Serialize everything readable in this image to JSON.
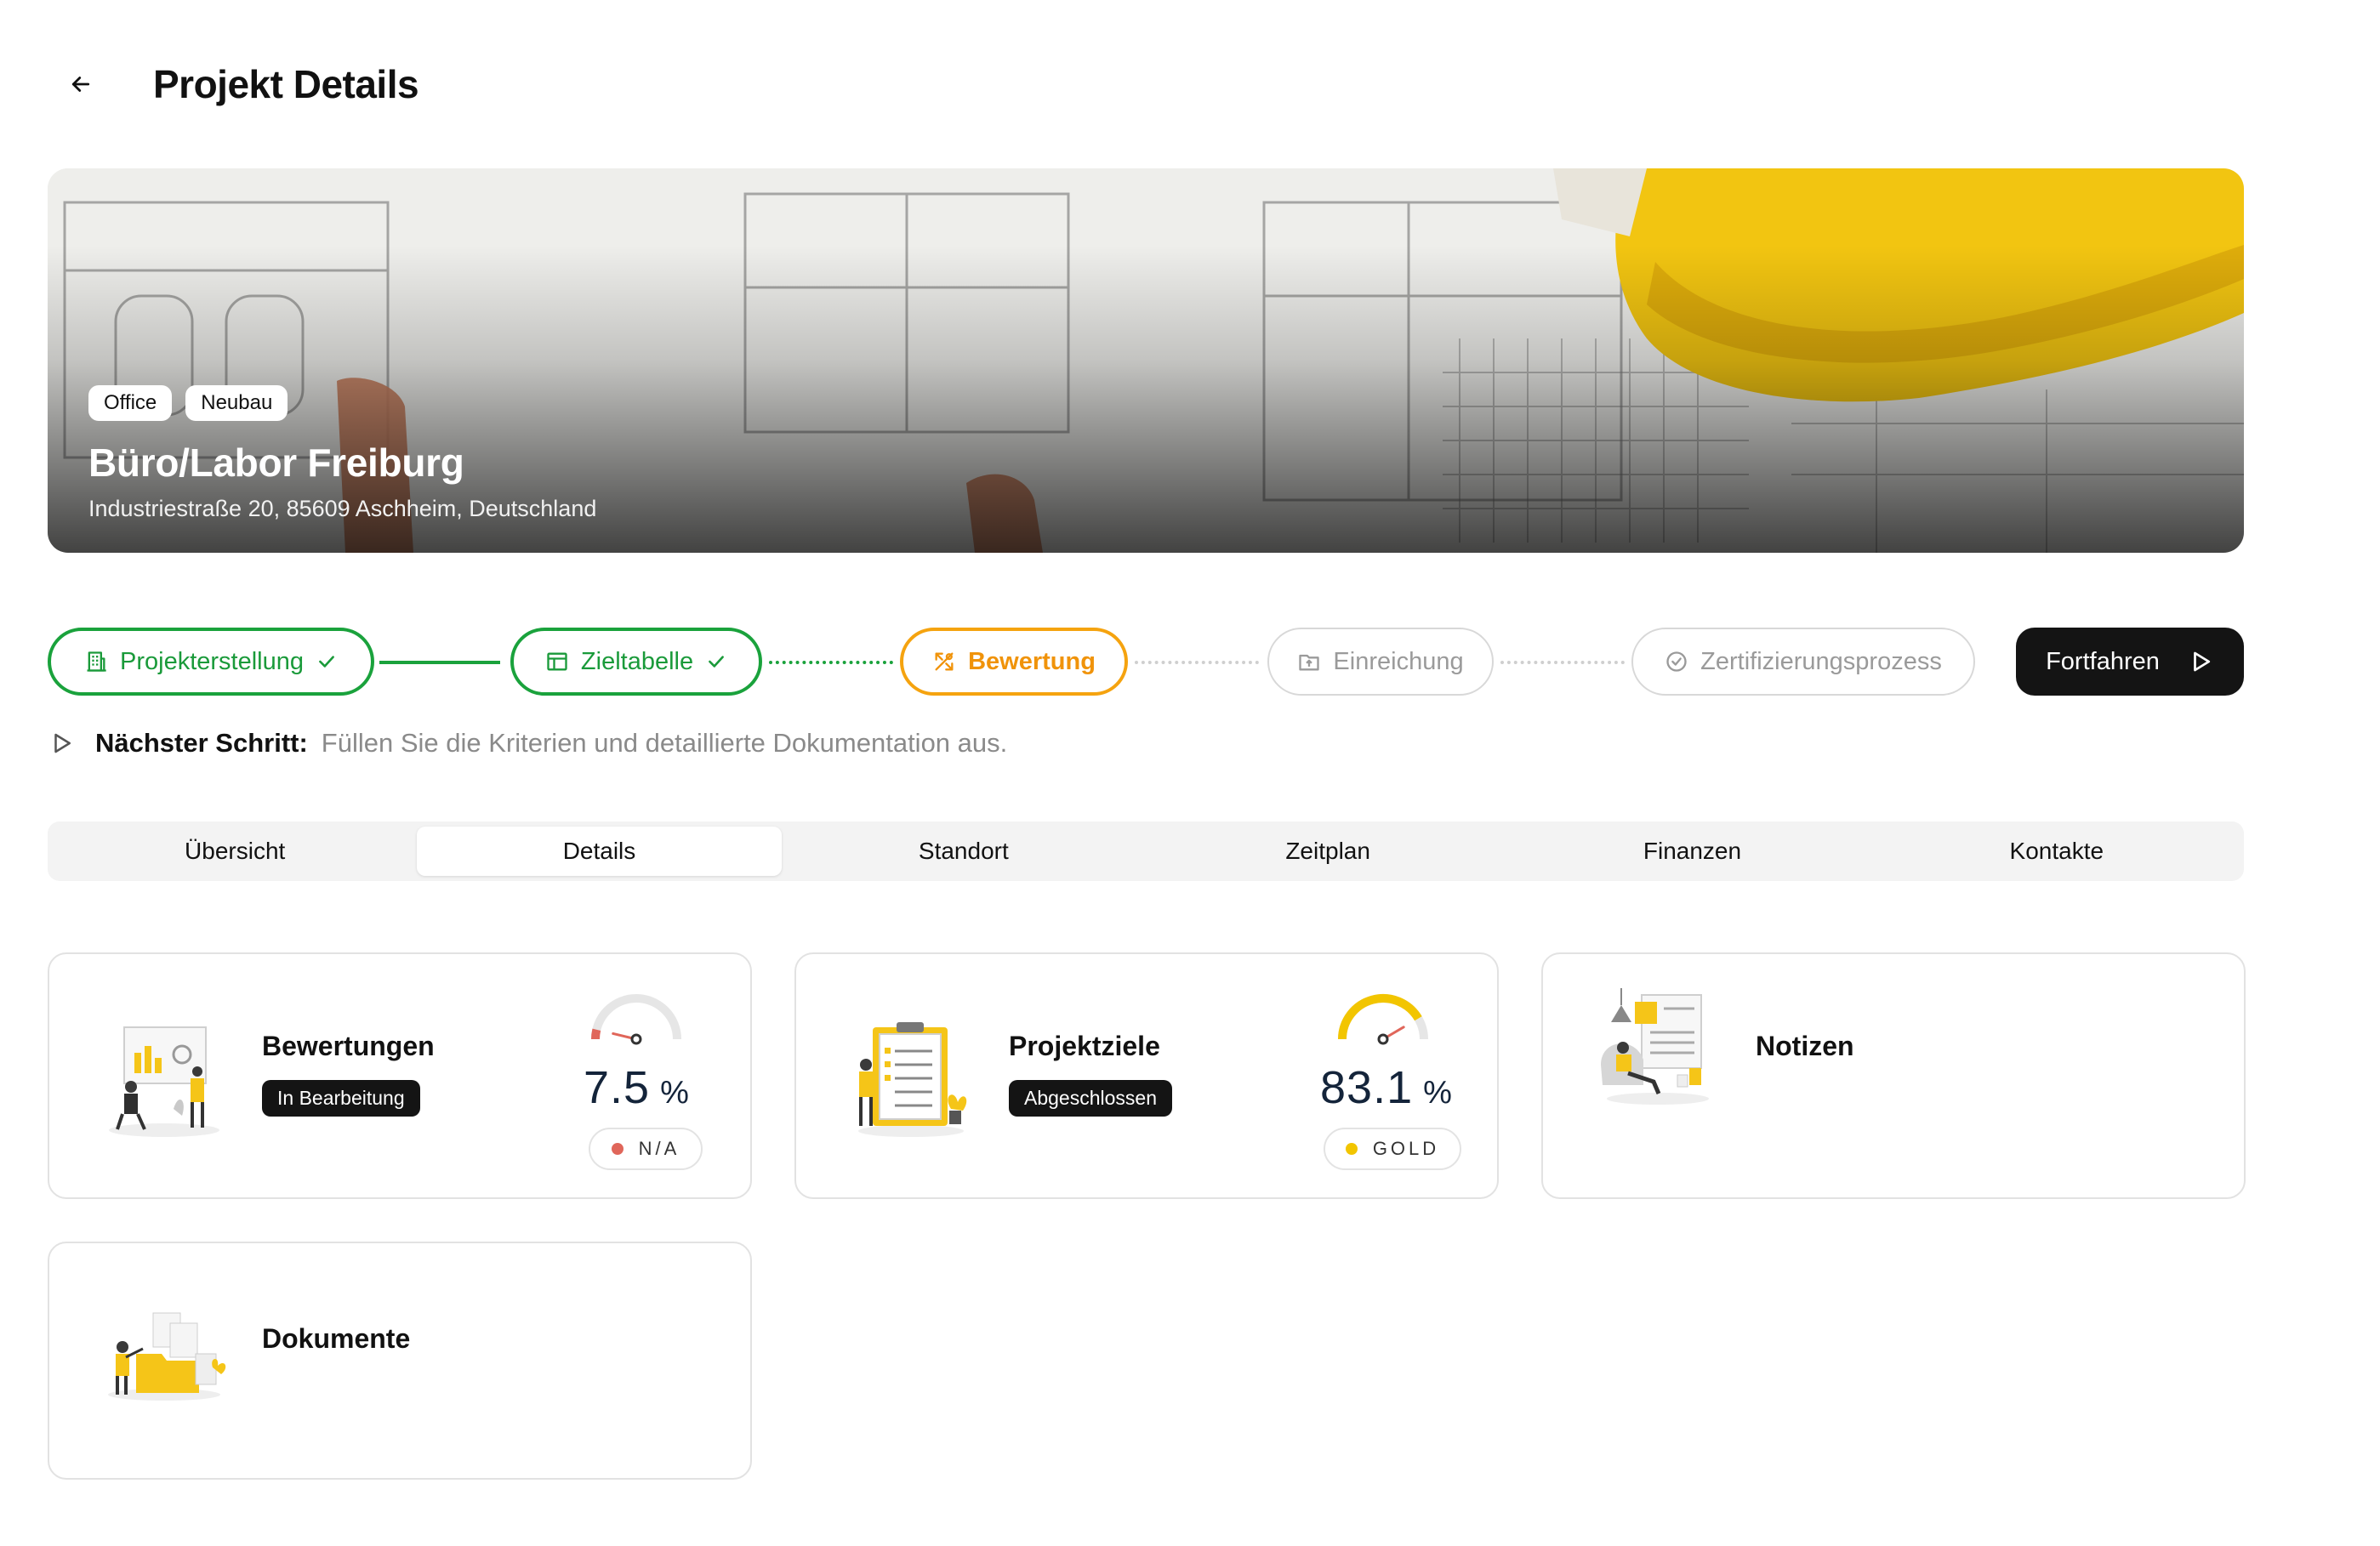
{
  "page": {
    "title": "Projekt Details",
    "back_icon": "arrow-left-icon"
  },
  "project": {
    "tags": [
      "Office",
      "Neubau"
    ],
    "name": "Büro/Labor Freiburg",
    "address": "Industriestraße 20, 85609 Aschheim, Deutschland"
  },
  "stepper": {
    "steps": [
      {
        "label": "Projekterstellung",
        "state": "completed",
        "icon": "building-icon"
      },
      {
        "label": "Zieltabelle",
        "state": "completed",
        "icon": "table-icon"
      },
      {
        "label": "Bewertung",
        "state": "active",
        "icon": "tools-icon"
      },
      {
        "label": "Einreichung",
        "state": "pending",
        "icon": "folder-upload-icon"
      },
      {
        "label": "Zertifizierungsprozess",
        "state": "pending",
        "icon": "check-circle-icon"
      }
    ],
    "continue_label": "Fortfahren"
  },
  "next_step": {
    "label": "Nächster Schritt:",
    "text": "Füllen Sie die Kriterien und detaillierte Dokumentation aus."
  },
  "tabs": {
    "items": [
      "Übersicht",
      "Details",
      "Standort",
      "Zeitplan",
      "Finanzen",
      "Kontakte"
    ],
    "active": "Details"
  },
  "cards": {
    "bewertungen": {
      "title": "Bewertungen",
      "status": "In Bearbeitung",
      "score": "7.5",
      "unit": "%",
      "rating": "N/A",
      "rating_color": "#e0665a",
      "gauge_fraction": 0.075
    },
    "projektziele": {
      "title": "Projektziele",
      "status": "Abgeschlossen",
      "score": "83.1",
      "unit": "%",
      "rating": "GOLD",
      "rating_color": "#f2c500",
      "gauge_fraction": 0.831
    },
    "notizen": {
      "title": "Notizen"
    },
    "dokumente": {
      "title": "Dokumente"
    }
  },
  "colors": {
    "completed": "#1aa23c",
    "active": "#f5a30f",
    "pending": "#9a9a9a",
    "dark": "#141414",
    "accent_yellow": "#f5c518"
  }
}
